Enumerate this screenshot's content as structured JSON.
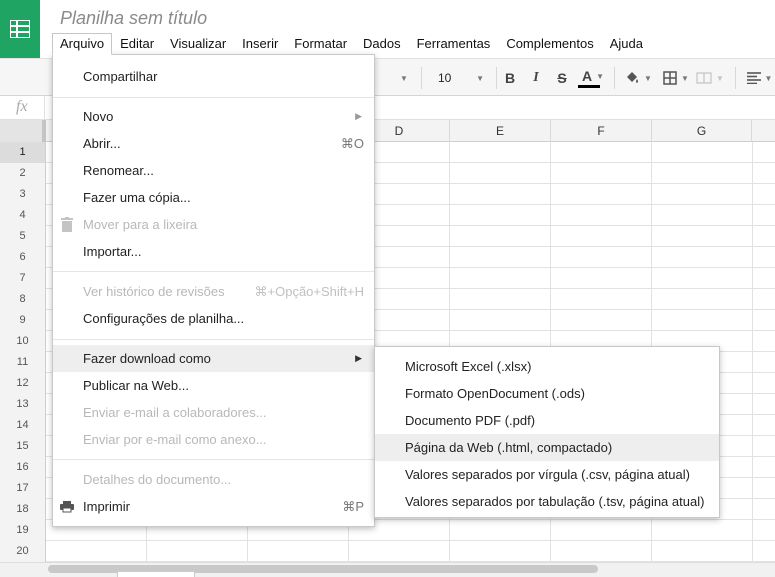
{
  "doc": {
    "title": "Planilha sem título"
  },
  "menubar": [
    "Arquivo",
    "Editar",
    "Visualizar",
    "Inserir",
    "Formatar",
    "Dados",
    "Ferramentas",
    "Complementos",
    "Ajuda"
  ],
  "toolbar": {
    "font_size": "10",
    "bold": "B",
    "italic": "I",
    "strike": "S",
    "text_color": "A"
  },
  "formula": {
    "fx": "fx"
  },
  "grid": {
    "columns": [
      "D",
      "E",
      "F",
      "G"
    ],
    "rows": [
      "1",
      "2",
      "3",
      "4",
      "5",
      "6",
      "7",
      "8",
      "9",
      "10",
      "11",
      "12",
      "13",
      "14",
      "15",
      "16",
      "17",
      "18",
      "19",
      "20"
    ]
  },
  "file_menu": {
    "share": "Compartilhar",
    "new": "Novo",
    "open": "Abrir...",
    "open_shortcut": "⌘O",
    "rename": "Renomear...",
    "copy": "Fazer uma cópia...",
    "trash": "Mover para a lixeira",
    "import": "Importar...",
    "history": "Ver histórico de revisões",
    "history_shortcut": "⌘+Opção+Shift+H",
    "settings": "Configurações de planilha...",
    "download": "Fazer download como",
    "publish": "Publicar na Web...",
    "email_collab": "Enviar e-mail a colaboradores...",
    "email_attach": "Enviar por e-mail como anexo...",
    "details": "Detalhes do documento...",
    "print": "Imprimir",
    "print_shortcut": "⌘P"
  },
  "download_submenu": [
    "Microsoft Excel (.xlsx)",
    "Formato OpenDocument (.ods)",
    "Documento PDF (.pdf)",
    "Página da Web (.html, compactado)",
    "Valores separados por vírgula (.csv, página atual)",
    "Valores separados por tabulação (.tsv, página atual)"
  ],
  "colors": {
    "brand": "#20a464",
    "highlight": "#eeeeee",
    "text_color_bar": "#000000"
  },
  "icons": [
    "sheets-logo-icon",
    "trash-icon",
    "print-icon",
    "paint-bucket-icon",
    "borders-icon",
    "merge-icon",
    "align-icon",
    "submenu-arrow-icon"
  ]
}
